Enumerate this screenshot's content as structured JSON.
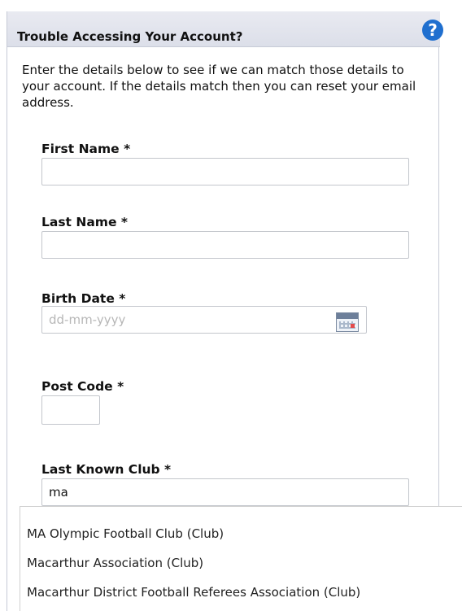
{
  "panel": {
    "title": "Trouble Accessing Your Account?",
    "help_icon": "?",
    "intro_text": "Enter the details below to see if we can match those details to your account. If the details match then you can reset your email address."
  },
  "form": {
    "first_name": {
      "label": "First Name *",
      "value": ""
    },
    "last_name": {
      "label": "Last Name *",
      "value": ""
    },
    "birth_date": {
      "label": "Birth Date *",
      "value": "",
      "placeholder": "dd-mm-yyyy",
      "icon": "calendar-icon"
    },
    "post_code": {
      "label": "Post Code *",
      "value": ""
    },
    "last_known_club": {
      "label": "Last Known Club *",
      "value": "ma"
    }
  },
  "autocomplete": {
    "options": [
      "MA Olympic Football Club (Club)",
      "Macarthur Association (Club)",
      "Macarthur District Football Referees Association (Club)"
    ]
  },
  "colors": {
    "help_icon": "#1f6fcf",
    "header_bg": "#dcdfe9",
    "border": "#c7cbd6"
  }
}
